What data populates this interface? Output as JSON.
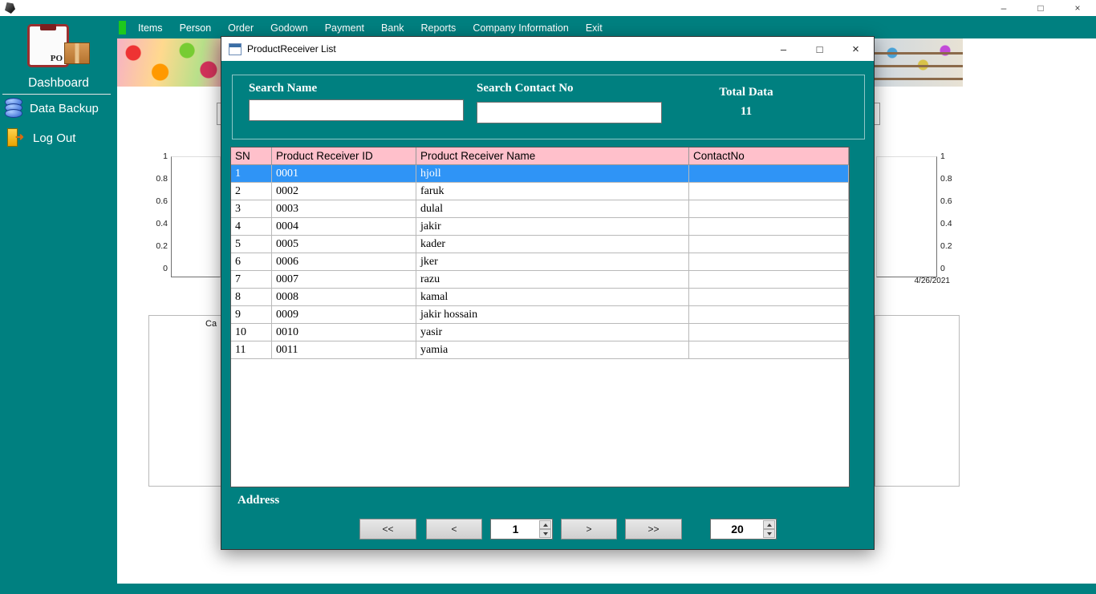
{
  "app": {
    "window_controls": {
      "minimize": "–",
      "maximize": "□",
      "close": "×"
    }
  },
  "menu": {
    "items": [
      "Items",
      "Person",
      "Order",
      "Godown",
      "Payment",
      "Bank",
      "Reports",
      "Company Information",
      "Exit"
    ]
  },
  "sidebar": {
    "logo_text": "PO",
    "dashboard": "Dashboard",
    "data_backup": "Data Backup",
    "log_out": "Log Out"
  },
  "background": {
    "axis_ticks": [
      "1",
      "0.8",
      "0.6",
      "0.4",
      "0.2",
      "0"
    ],
    "date_label": "4/26/2021",
    "partial_label": "Ca"
  },
  "dialog": {
    "title": "ProductReceiver List",
    "controls": {
      "minimize": "–",
      "maximize": "□",
      "close": "×"
    },
    "search_name_label": "Search Name",
    "search_contact_label": "Search Contact No",
    "total_data_label": "Total Data",
    "total_count": "11",
    "address_label": "Address",
    "grid": {
      "columns": [
        "SN",
        "Product Receiver ID",
        "Product Receiver Name",
        "ContactNo"
      ],
      "selected_row_index": 0,
      "rows": [
        {
          "sn": "1",
          "id": "0001",
          "name": "hjoll",
          "contact": ""
        },
        {
          "sn": "2",
          "id": "0002",
          "name": "faruk",
          "contact": ""
        },
        {
          "sn": "3",
          "id": "0003",
          "name": "dulal",
          "contact": ""
        },
        {
          "sn": "4",
          "id": "0004",
          "name": "jakir",
          "contact": ""
        },
        {
          "sn": "5",
          "id": "0005",
          "name": "kader",
          "contact": ""
        },
        {
          "sn": "6",
          "id": "0006",
          "name": "jker",
          "contact": ""
        },
        {
          "sn": "7",
          "id": "0007",
          "name": "razu",
          "contact": ""
        },
        {
          "sn": "8",
          "id": "0008",
          "name": "kamal",
          "contact": ""
        },
        {
          "sn": "9",
          "id": "0009",
          "name": "jakir hossain",
          "contact": ""
        },
        {
          "sn": "10",
          "id": "0010",
          "name": "yasir",
          "contact": ""
        },
        {
          "sn": "11",
          "id": "0011",
          "name": "yamia",
          "contact": ""
        }
      ]
    },
    "pagination": {
      "first": "<<",
      "prev": "<",
      "page_value": "1",
      "next": ">",
      "last": ">>",
      "page_size_value": "20"
    }
  },
  "colors": {
    "teal": "#008080",
    "grid_header_pink": "#ffc0cb",
    "selection_blue": "#2f94f6",
    "menu_indicator_green": "#1dc81d"
  }
}
